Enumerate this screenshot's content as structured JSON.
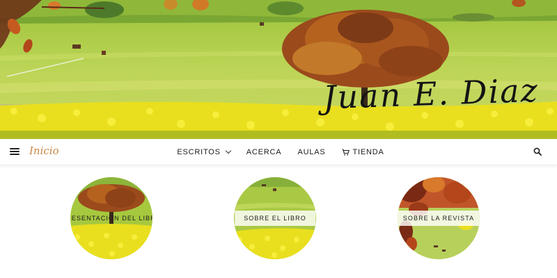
{
  "site": {
    "title": "Juan E. Diaz"
  },
  "navbar": {
    "home_label": "Inicio",
    "items": [
      {
        "label": "ESCRITOS",
        "has_dropdown": true
      },
      {
        "label": "ACERCA"
      },
      {
        "label": "AULAS"
      },
      {
        "label": "TIENDA",
        "icon": "cart-icon"
      }
    ],
    "menu_icon": "hamburger-icon",
    "search_icon": "search-icon"
  },
  "promos": [
    {
      "label": "PRESENTACIÓN DEL LIBRO",
      "image": "autumn-tree-field"
    },
    {
      "label": "SOBRE EL LIBRO",
      "image": "green-pasture-flowers"
    },
    {
      "label": "SOBRE LA REVISTA",
      "image": "autumn-leaves-meadow"
    }
  ],
  "colors": {
    "accent": "#c9874a",
    "text": "#1a1a1a",
    "meadow": "#b5cf4a",
    "flowers": "#f2e528"
  }
}
